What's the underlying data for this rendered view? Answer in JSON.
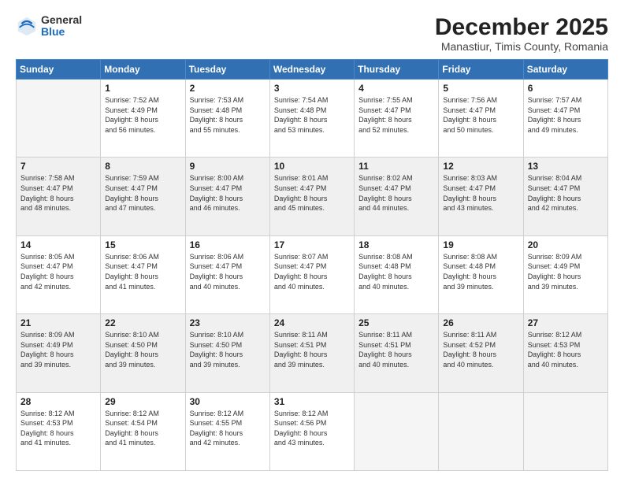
{
  "header": {
    "logo": {
      "line1": "General",
      "line2": "Blue"
    },
    "title": "December 2025",
    "subtitle": "Manastiur, Timis County, Romania"
  },
  "calendar": {
    "days_of_week": [
      "Sunday",
      "Monday",
      "Tuesday",
      "Wednesday",
      "Thursday",
      "Friday",
      "Saturday"
    ],
    "weeks": [
      {
        "shaded": false,
        "days": [
          {
            "date": "",
            "info": ""
          },
          {
            "date": "1",
            "info": "Sunrise: 7:52 AM\nSunset: 4:49 PM\nDaylight: 8 hours\nand 56 minutes."
          },
          {
            "date": "2",
            "info": "Sunrise: 7:53 AM\nSunset: 4:48 PM\nDaylight: 8 hours\nand 55 minutes."
          },
          {
            "date": "3",
            "info": "Sunrise: 7:54 AM\nSunset: 4:48 PM\nDaylight: 8 hours\nand 53 minutes."
          },
          {
            "date": "4",
            "info": "Sunrise: 7:55 AM\nSunset: 4:47 PM\nDaylight: 8 hours\nand 52 minutes."
          },
          {
            "date": "5",
            "info": "Sunrise: 7:56 AM\nSunset: 4:47 PM\nDaylight: 8 hours\nand 50 minutes."
          },
          {
            "date": "6",
            "info": "Sunrise: 7:57 AM\nSunset: 4:47 PM\nDaylight: 8 hours\nand 49 minutes."
          }
        ]
      },
      {
        "shaded": true,
        "days": [
          {
            "date": "7",
            "info": "Sunrise: 7:58 AM\nSunset: 4:47 PM\nDaylight: 8 hours\nand 48 minutes."
          },
          {
            "date": "8",
            "info": "Sunrise: 7:59 AM\nSunset: 4:47 PM\nDaylight: 8 hours\nand 47 minutes."
          },
          {
            "date": "9",
            "info": "Sunrise: 8:00 AM\nSunset: 4:47 PM\nDaylight: 8 hours\nand 46 minutes."
          },
          {
            "date": "10",
            "info": "Sunrise: 8:01 AM\nSunset: 4:47 PM\nDaylight: 8 hours\nand 45 minutes."
          },
          {
            "date": "11",
            "info": "Sunrise: 8:02 AM\nSunset: 4:47 PM\nDaylight: 8 hours\nand 44 minutes."
          },
          {
            "date": "12",
            "info": "Sunrise: 8:03 AM\nSunset: 4:47 PM\nDaylight: 8 hours\nand 43 minutes."
          },
          {
            "date": "13",
            "info": "Sunrise: 8:04 AM\nSunset: 4:47 PM\nDaylight: 8 hours\nand 42 minutes."
          }
        ]
      },
      {
        "shaded": false,
        "days": [
          {
            "date": "14",
            "info": "Sunrise: 8:05 AM\nSunset: 4:47 PM\nDaylight: 8 hours\nand 42 minutes."
          },
          {
            "date": "15",
            "info": "Sunrise: 8:06 AM\nSunset: 4:47 PM\nDaylight: 8 hours\nand 41 minutes."
          },
          {
            "date": "16",
            "info": "Sunrise: 8:06 AM\nSunset: 4:47 PM\nDaylight: 8 hours\nand 40 minutes."
          },
          {
            "date": "17",
            "info": "Sunrise: 8:07 AM\nSunset: 4:47 PM\nDaylight: 8 hours\nand 40 minutes."
          },
          {
            "date": "18",
            "info": "Sunrise: 8:08 AM\nSunset: 4:48 PM\nDaylight: 8 hours\nand 40 minutes."
          },
          {
            "date": "19",
            "info": "Sunrise: 8:08 AM\nSunset: 4:48 PM\nDaylight: 8 hours\nand 39 minutes."
          },
          {
            "date": "20",
            "info": "Sunrise: 8:09 AM\nSunset: 4:49 PM\nDaylight: 8 hours\nand 39 minutes."
          }
        ]
      },
      {
        "shaded": true,
        "days": [
          {
            "date": "21",
            "info": "Sunrise: 8:09 AM\nSunset: 4:49 PM\nDaylight: 8 hours\nand 39 minutes."
          },
          {
            "date": "22",
            "info": "Sunrise: 8:10 AM\nSunset: 4:50 PM\nDaylight: 8 hours\nand 39 minutes."
          },
          {
            "date": "23",
            "info": "Sunrise: 8:10 AM\nSunset: 4:50 PM\nDaylight: 8 hours\nand 39 minutes."
          },
          {
            "date": "24",
            "info": "Sunrise: 8:11 AM\nSunset: 4:51 PM\nDaylight: 8 hours\nand 39 minutes."
          },
          {
            "date": "25",
            "info": "Sunrise: 8:11 AM\nSunset: 4:51 PM\nDaylight: 8 hours\nand 40 minutes."
          },
          {
            "date": "26",
            "info": "Sunrise: 8:11 AM\nSunset: 4:52 PM\nDaylight: 8 hours\nand 40 minutes."
          },
          {
            "date": "27",
            "info": "Sunrise: 8:12 AM\nSunset: 4:53 PM\nDaylight: 8 hours\nand 40 minutes."
          }
        ]
      },
      {
        "shaded": false,
        "days": [
          {
            "date": "28",
            "info": "Sunrise: 8:12 AM\nSunset: 4:53 PM\nDaylight: 8 hours\nand 41 minutes."
          },
          {
            "date": "29",
            "info": "Sunrise: 8:12 AM\nSunset: 4:54 PM\nDaylight: 8 hours\nand 41 minutes."
          },
          {
            "date": "30",
            "info": "Sunrise: 8:12 AM\nSunset: 4:55 PM\nDaylight: 8 hours\nand 42 minutes."
          },
          {
            "date": "31",
            "info": "Sunrise: 8:12 AM\nSunset: 4:56 PM\nDaylight: 8 hours\nand 43 minutes."
          },
          {
            "date": "",
            "info": ""
          },
          {
            "date": "",
            "info": ""
          },
          {
            "date": "",
            "info": ""
          }
        ]
      }
    ]
  }
}
